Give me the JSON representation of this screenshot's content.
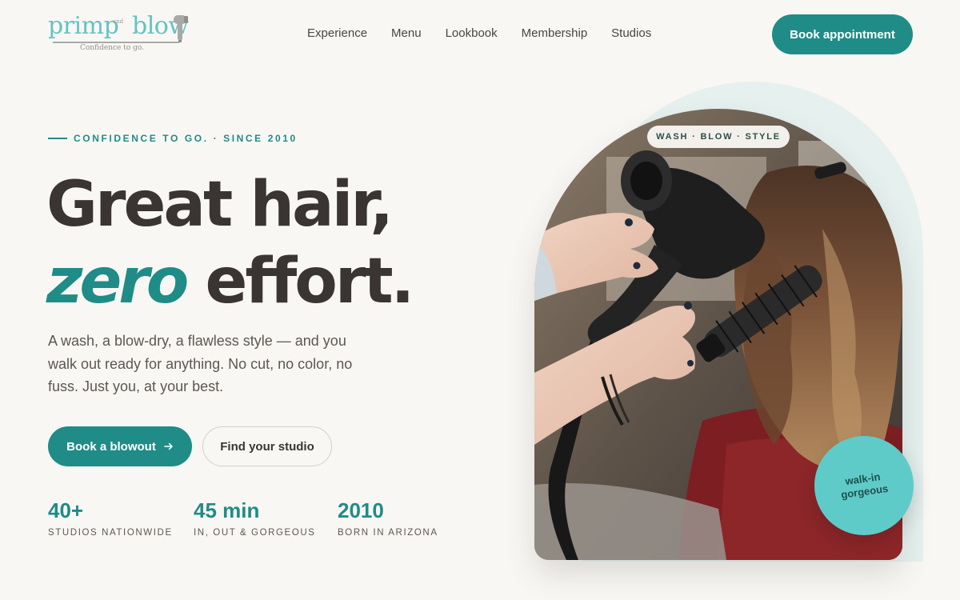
{
  "brand": {
    "logo_primp": "primp",
    "logo_and": "and",
    "logo_blow": "blow",
    "tagline": "Confidence to go."
  },
  "nav": {
    "items": [
      "Experience",
      "Menu",
      "Lookbook",
      "Membership",
      "Studios"
    ],
    "cta": "Book appointment"
  },
  "hero": {
    "eyebrow": "CONFIDENCE TO GO. · SINCE 2010",
    "headline_line1": "Great hair,",
    "headline_accent": "zero",
    "headline_rest": " effort.",
    "subcopy": "A wash, a blow-dry, a flawless style — and you walk out ready for anything. No cut, no color, no fuss. Just you, at your best.",
    "primary_cta": "Book a blowout",
    "primary_cta_icon": "arrow-right-icon",
    "secondary_cta": "Find your studio",
    "stats": [
      {
        "value": "40+",
        "label": "STUDIOS NATIONWIDE"
      },
      {
        "value": "45 min",
        "label": "IN, OUT & GORGEOUS"
      },
      {
        "value": "2010",
        "label": "BORN IN ARIZONA"
      }
    ],
    "image_tag": "WASH · BLOW · STYLE",
    "badge_line1": "walk-in",
    "badge_line2": "gorgeous"
  },
  "colors": {
    "accent": "#1f8c87",
    "logo": "#62c4c3",
    "badge": "#5ecbc9",
    "background": "#f9f7f3",
    "text": "#3a3532"
  }
}
